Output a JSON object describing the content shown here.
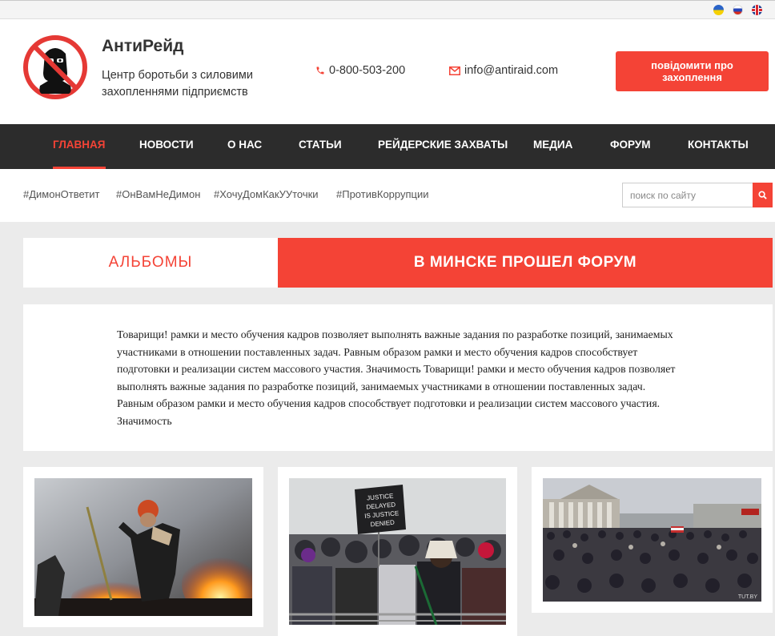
{
  "languages": [
    {
      "code": "ua",
      "icon": "ukraine-flag-icon"
    },
    {
      "code": "ru",
      "icon": "russia-flag-icon"
    },
    {
      "code": "en",
      "icon": "uk-flag-icon"
    }
  ],
  "header": {
    "brand_name": "АнтиРейд",
    "tagline": "Центр боротьби з силовими захопленнями підприємств",
    "phone": "0-800-503-200",
    "email": "info@antiraid.com",
    "report_button": "повідомити про захоплення"
  },
  "nav": {
    "items": [
      {
        "label": "ГЛАВНАЯ",
        "active": true
      },
      {
        "label": "НОВОСТИ",
        "active": false
      },
      {
        "label": "О НАС",
        "active": false
      },
      {
        "label": "СТАТЬИ",
        "active": false
      },
      {
        "label": "РЕЙДЕРСКИЕ ЗАХВАТЫ",
        "active": false
      },
      {
        "label": "МЕДИА",
        "active": false
      },
      {
        "label": "ФОРУМ",
        "active": false
      },
      {
        "label": "КОНТАКТЫ",
        "active": false
      }
    ]
  },
  "tags": [
    "#ДимонОтветит",
    "#ОнВамНеДимон",
    "#ХочуДомКакУУточки",
    "#ПротивКоррупции"
  ],
  "search": {
    "placeholder": "поиск по сайту"
  },
  "tabs": {
    "albums": "АЛЬБОМЫ",
    "featured": "В МИНСКЕ ПРОШЕЛ ФОРУМ"
  },
  "article_text": "Товарищи! рамки и место обучения кадров позволяет выполнять важные задания по разработке позиций, занимаемых участниками в отношении поставленных задач. Равным образом рамки и место обучения кадров способствует подготовки и реализации систем массового участия. Значимость Товарищи! рамки и место обучения кадров позволяет выполнять важные задания по разработке позиций, занимаемых участниками в отношении поставленных задач. Равным образом рамки и место обучения кадров способствует подготовки и реализации систем массового участия. Значимость",
  "gallery": {
    "sign_text": [
      "JUSTICE",
      "DELAYED",
      "IS JUSTICE",
      "DENIED"
    ],
    "watermark": "TUT.BY"
  },
  "colors": {
    "accent": "#f44336",
    "nav_bg": "#2c2c2c",
    "page_bg": "#ebebeb"
  }
}
